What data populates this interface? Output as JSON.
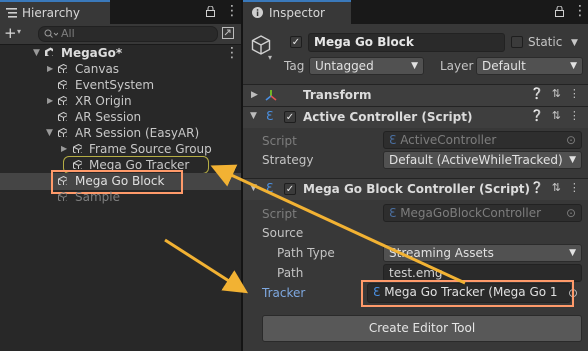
{
  "hierarchy": {
    "tab_title": "Hierarchy",
    "search_placeholder": "All",
    "items": [
      {
        "label": "MegaGo*"
      },
      {
        "label": "Canvas"
      },
      {
        "label": "EventSystem"
      },
      {
        "label": "XR Origin"
      },
      {
        "label": "AR Session"
      },
      {
        "label": "AR Session (EasyAR)"
      },
      {
        "label": "Frame Source Group"
      },
      {
        "label": "Mega Go Tracker"
      },
      {
        "label": "Mega Go Block"
      },
      {
        "label": "Sample"
      }
    ]
  },
  "inspector": {
    "tab_title": "Inspector",
    "object_name": "Mega Go Block",
    "static_label": "Static",
    "tag_label": "Tag",
    "tag_value": "Untagged",
    "layer_label": "Layer",
    "layer_value": "Default",
    "components": {
      "transform": {
        "title": "Transform"
      },
      "active_controller": {
        "title": "Active Controller (Script)",
        "script_label": "Script",
        "script_value": "ActiveController",
        "strategy_label": "Strategy",
        "strategy_value": "Default (ActiveWhileTracked)"
      },
      "block_controller": {
        "title": "Mega Go Block Controller (Script)",
        "script_label": "Script",
        "script_value": "MegaGoBlockController",
        "source_label": "Source",
        "path_type_label": "Path Type",
        "path_type_value": "Streaming Assets",
        "path_label": "Path",
        "path_value": "test.emg",
        "tracker_label": "Tracker",
        "tracker_value": "Mega Go Tracker (Mega Go 1"
      }
    },
    "create_button": "Create Editor Tool"
  },
  "colors": {
    "accent": "#3a79bb",
    "annotation_orange": "#ff9a6a",
    "arrow_yellow": "#f2b233",
    "highlight_olive": "#b5ad44"
  }
}
